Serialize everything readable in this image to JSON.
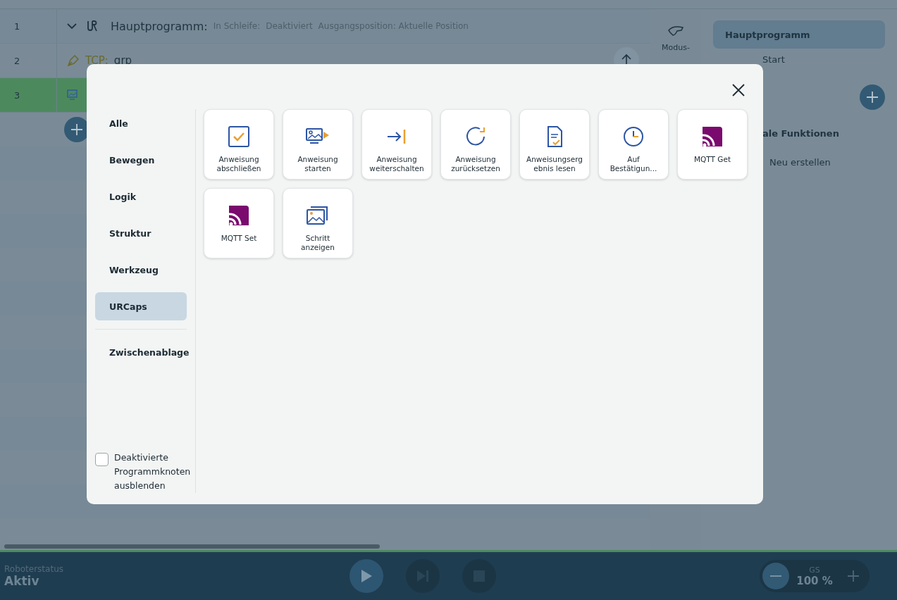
{
  "program_rows": [
    {
      "number": "1",
      "kind": "main",
      "label": "Hauptprogramm:",
      "details": [
        "In Schleife:",
        "Deaktiviert",
        "Ausgangsposition: Aktuelle Position"
      ],
      "selected": false
    },
    {
      "number": "2",
      "kind": "tcp",
      "label": "TCP:",
      "value": "grp",
      "selected": false
    },
    {
      "number": "3",
      "kind": "step",
      "selected": true
    }
  ],
  "side_tool": {
    "label": "Modus-"
  },
  "right_panel": {
    "items": [
      {
        "label": "Hauptprogramm",
        "selected": true
      },
      {
        "label": "Start",
        "selected": false
      }
    ],
    "section_title": "ale Funktionen",
    "create_label": "Neu erstellen"
  },
  "dialog": {
    "categories": [
      {
        "label": "Alle",
        "selected": false
      },
      {
        "label": "Bewegen",
        "selected": false
      },
      {
        "label": "Logik",
        "selected": false
      },
      {
        "label": "Struktur",
        "selected": false
      },
      {
        "label": "Werkzeug",
        "selected": false
      },
      {
        "label": "URCaps",
        "selected": true
      }
    ],
    "clipboard": "Zwischenablage",
    "hide_disabled": {
      "label": "Deaktivierte Programmknoten ausblenden",
      "checked": false
    },
    "nodes": [
      {
        "label": "Anweisung abschließen",
        "kind": "finish"
      },
      {
        "label": "Anweisung starten",
        "kind": "start"
      },
      {
        "label": "Anweisung weiterschalten",
        "kind": "advance"
      },
      {
        "label": "Anweisung zurücksetzen",
        "kind": "reset"
      },
      {
        "label": "Anweisungsergebnis lesen",
        "kind": "result"
      },
      {
        "label": "Auf Bestätigun...",
        "kind": "wait"
      },
      {
        "label": "MQTT Get",
        "kind": "mqtt"
      },
      {
        "label": "MQTT Set",
        "kind": "mqtt"
      },
      {
        "label": "Schritt anzeigen",
        "kind": "show"
      }
    ]
  },
  "status_bar": {
    "status_label": "Roboterstatus",
    "status": "Aktiv",
    "speed_label": "GS",
    "speed": "100 %"
  }
}
